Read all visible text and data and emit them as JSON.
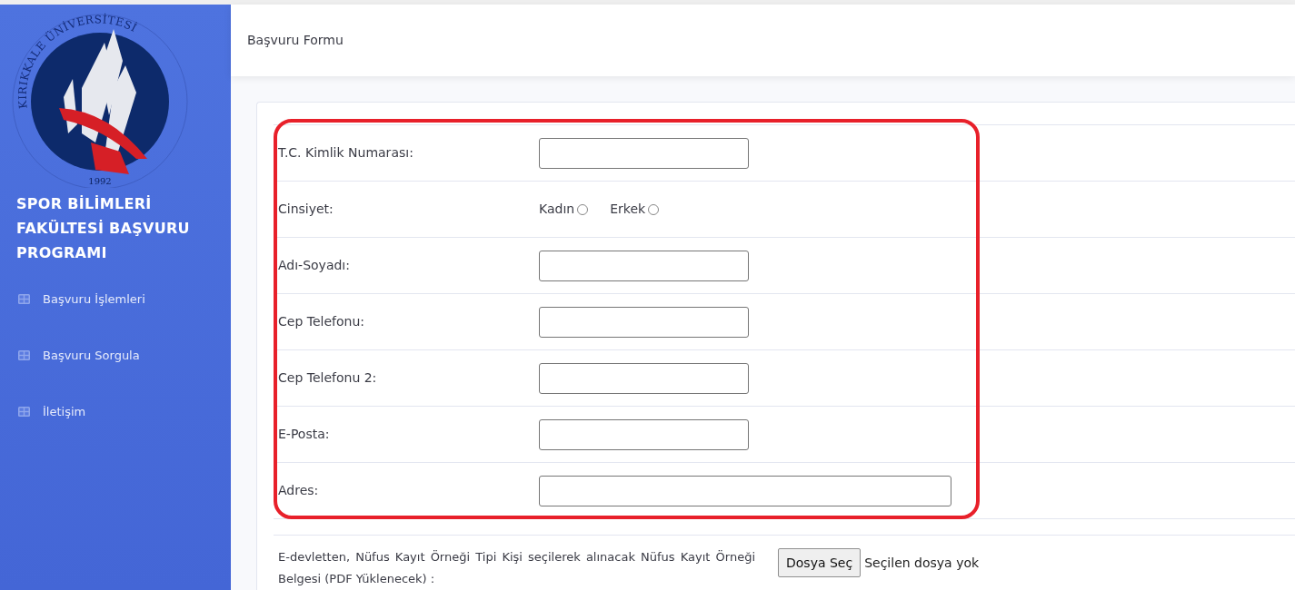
{
  "sidebar": {
    "logo": {
      "ring_text": "KIRIKKALE ÜNİVERSİTESİ",
      "year": "1992"
    },
    "title": "SPOR BİLİMLERİ FAKÜLTESİ BAŞVURU PROGRAMI",
    "items": [
      {
        "label": "Başvuru İşlemleri"
      },
      {
        "label": "Başvuru Sorgula"
      },
      {
        "label": "İletişim"
      }
    ]
  },
  "header": {
    "title": "Başvuru Formu"
  },
  "form": {
    "fields": [
      {
        "kind": "text",
        "label": "T.C. Kimlik Numarası:"
      },
      {
        "kind": "radio",
        "label": "Cinsiyet:",
        "options": [
          {
            "label": "Kadın",
            "selected": false
          },
          {
            "label": "Erkek",
            "selected": false
          }
        ]
      },
      {
        "kind": "text",
        "label": "Adı-Soyadı:"
      },
      {
        "kind": "text",
        "label": "Cep Telefonu:"
      },
      {
        "kind": "text",
        "label": "Cep Telefonu 2:"
      },
      {
        "kind": "text",
        "label": "E-Posta:"
      },
      {
        "kind": "wide",
        "label": "Adres:"
      }
    ],
    "upload": {
      "label": "E-devletten, Nüfus Kayıt Örneği Tipi Kişi seçilerek alınacak Nüfus Kayıt Örneği Belgesi (PDF Yüklenecek) :",
      "button": "Dosya Seç",
      "status": "Seçilen dosya yok"
    }
  }
}
